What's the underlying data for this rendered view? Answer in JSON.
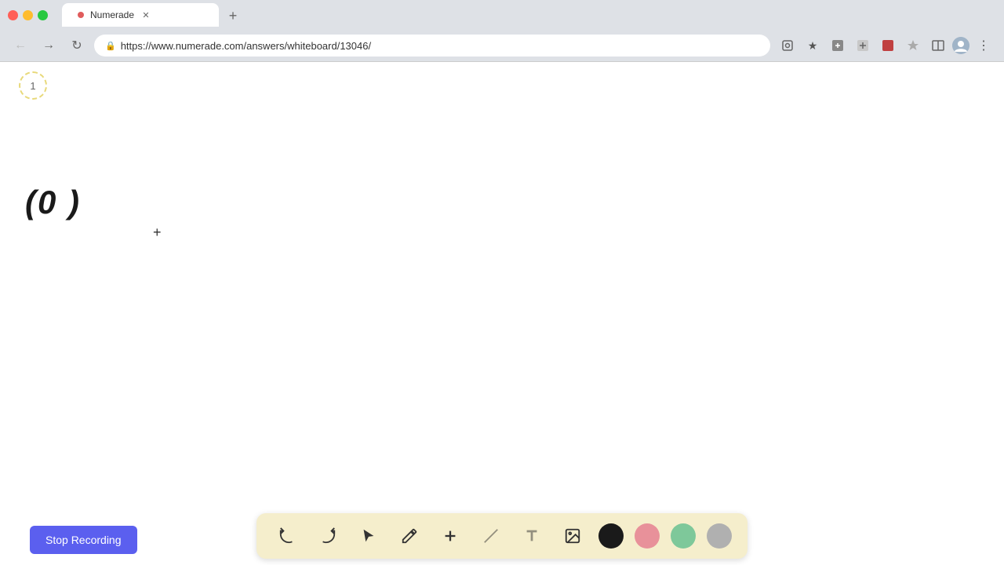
{
  "browser": {
    "tab_title": "Numerade",
    "tab_dot_color": "#e05c5c",
    "url": "https://www.numerade.com/answers/whiteboard/13046/",
    "new_tab_label": "+"
  },
  "toolbar": {
    "stop_recording_label": "Stop Recording",
    "stop_recording_color": "#5b5fef"
  },
  "canvas": {
    "page_number": "1",
    "math_expression": "(0 )"
  },
  "tools": {
    "undo_label": "undo",
    "redo_label": "redo",
    "select_label": "select",
    "pen_label": "pen",
    "plus_label": "plus",
    "eraser_label": "eraser",
    "text_label": "text",
    "image_label": "image"
  },
  "colors": {
    "black": "#1a1a1a",
    "pink": "#e8919a",
    "green": "#7ec89a",
    "gray": "#b0b0b0"
  }
}
